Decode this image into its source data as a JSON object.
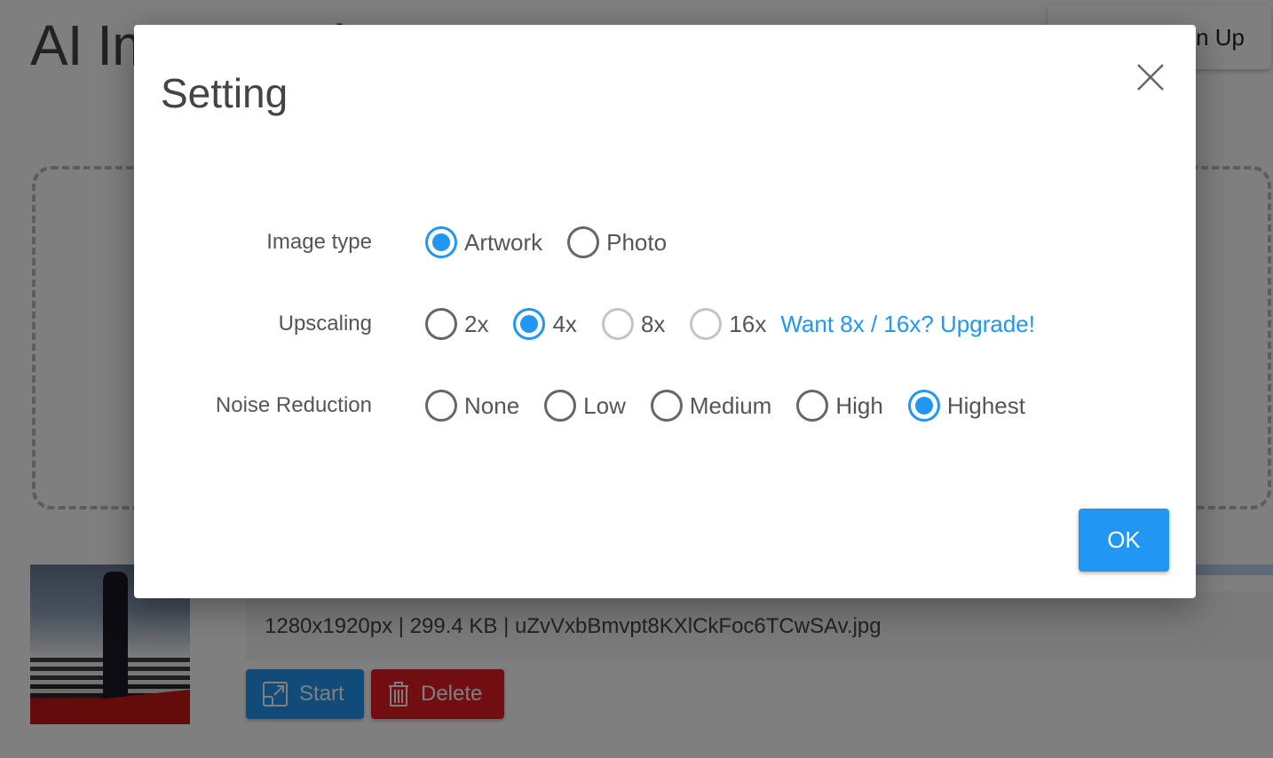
{
  "page": {
    "app_title": "AI Image Enlarger",
    "signup_label": "Sign Up"
  },
  "file": {
    "info": "1280x1920px | 299.4 KB | uZvVxbBmvpt8KXlCkFoc6TCwSAv.jpg",
    "progress_percent": 100,
    "start_label": "Start",
    "delete_label": "Delete",
    "start_icon": "expand-icon",
    "delete_icon": "trash-icon"
  },
  "modal": {
    "title": "Setting",
    "close_icon": "close-icon",
    "ok_label": "OK",
    "accent_color": "#2196f3",
    "rows": [
      {
        "label": "Image type",
        "options": [
          {
            "label": "Artwork",
            "checked": true,
            "disabled": false
          },
          {
            "label": "Photo",
            "checked": false,
            "disabled": false
          }
        ]
      },
      {
        "label": "Upscaling",
        "options": [
          {
            "label": "2x",
            "checked": false,
            "disabled": false
          },
          {
            "label": "4x",
            "checked": true,
            "disabled": false
          },
          {
            "label": "8x",
            "checked": false,
            "disabled": true
          },
          {
            "label": "16x",
            "checked": false,
            "disabled": true
          }
        ],
        "upgrade_link": "Want 8x / 16x? Upgrade!"
      },
      {
        "label": "Noise Reduction",
        "options": [
          {
            "label": "None",
            "checked": false,
            "disabled": false
          },
          {
            "label": "Low",
            "checked": false,
            "disabled": false
          },
          {
            "label": "Medium",
            "checked": false,
            "disabled": false
          },
          {
            "label": "High",
            "checked": false,
            "disabled": false
          },
          {
            "label": "Highest",
            "checked": true,
            "disabled": false
          }
        ]
      }
    ]
  }
}
